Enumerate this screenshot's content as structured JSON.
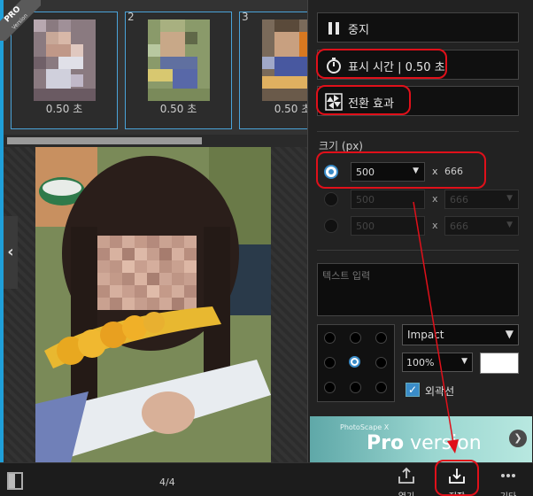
{
  "pro_ribbon": {
    "title": "PRO",
    "subtitle": "Version"
  },
  "thumbnails": [
    {
      "index": "",
      "duration": "0.50 초"
    },
    {
      "index": "2",
      "duration": "0.50 초"
    },
    {
      "index": "3",
      "duration": "0.50 초"
    }
  ],
  "controls": {
    "stop_label": "중지",
    "display_time_label": "표시 시간 | 0.50 초",
    "transition_label": "전환 효과"
  },
  "size": {
    "label": "크기 (px)",
    "times": "x",
    "rows": [
      {
        "width": "500",
        "height": "666",
        "selected": true
      },
      {
        "width": "500",
        "height": "666",
        "selected": false
      },
      {
        "width": "500",
        "height": "666",
        "selected": false
      }
    ]
  },
  "text_input": {
    "placeholder": "텍스트 입력"
  },
  "font": {
    "family": "Impact",
    "size": "100%",
    "outline_label": "외곽선"
  },
  "pro_banner": {
    "small": "PhotoScape X",
    "pro": "Pro",
    "version": " version"
  },
  "bottom": {
    "page_counter": "4/4",
    "open_label": "열기",
    "save_label": "저장",
    "more_label": "기타"
  },
  "colors": {
    "accent": "#1f9fd9",
    "highlight": "#e0101a",
    "selected_blue": "#3a8cc8"
  }
}
